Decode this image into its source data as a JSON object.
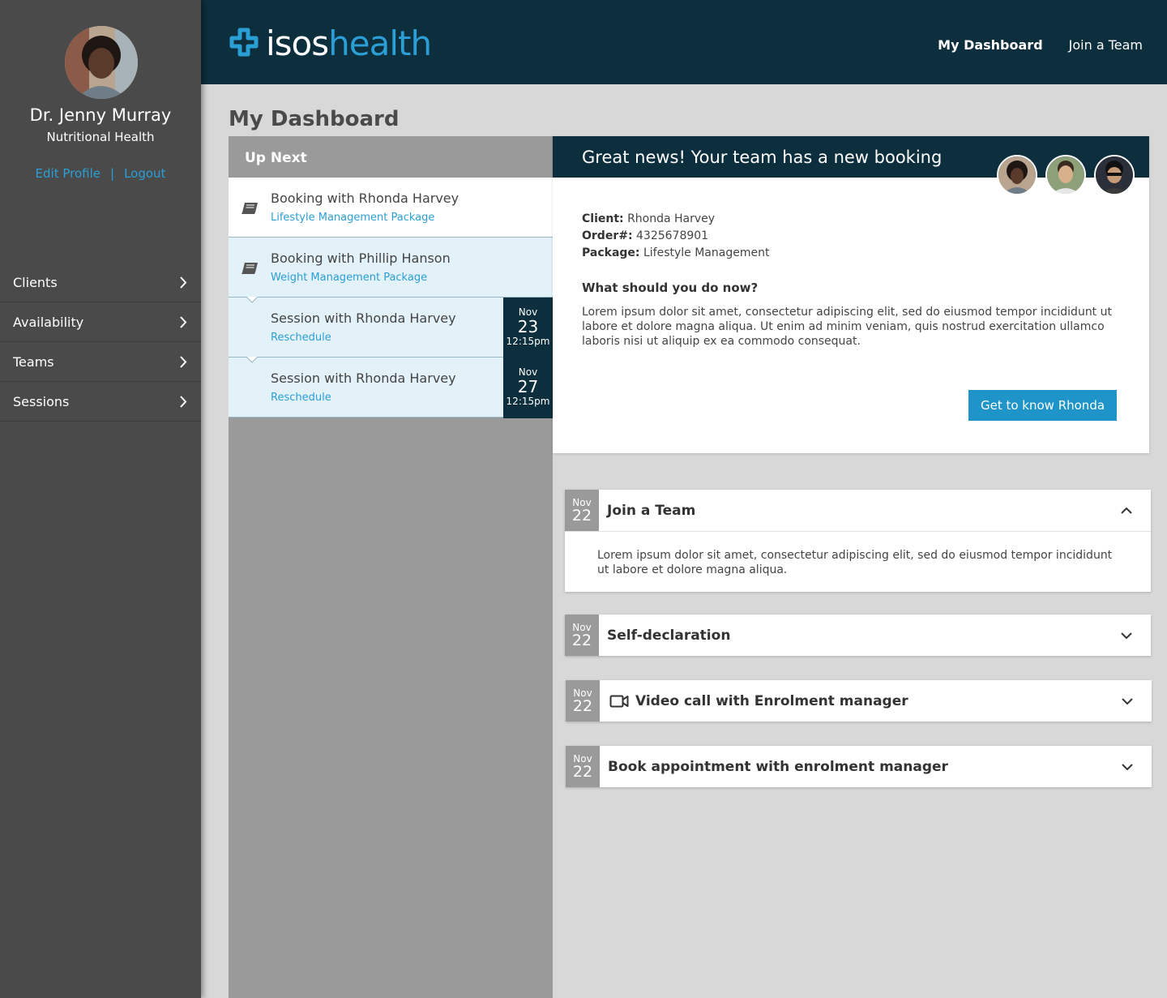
{
  "brand": {
    "logo_iso": "isos",
    "logo_health": "health",
    "accent_color": "#2a9fd6",
    "dark_color": "#0d2e3c"
  },
  "top_nav": {
    "dashboard": "My Dashboard",
    "join_team": "Join a Team"
  },
  "profile": {
    "name": "Dr. Jenny Murray",
    "role": "Nutritional Health",
    "edit_link": "Edit Profile",
    "separator": "|",
    "logout_link": "Logout"
  },
  "sidebar": {
    "items": [
      {
        "label": "Clients"
      },
      {
        "label": "Availability"
      },
      {
        "label": "Teams"
      },
      {
        "label": "Sessions"
      }
    ]
  },
  "page_title": "My Dashboard",
  "up_next": {
    "header": "Up Next",
    "items": [
      {
        "title": "Booking with Rhonda Harvey",
        "sub": "Lifestyle Management Package"
      },
      {
        "title": "Booking with Phillip Hanson",
        "sub": "Weight Management Package"
      },
      {
        "title": "Session with Rhonda Harvey",
        "sub": "Reschedule",
        "month": "Nov",
        "day": "23",
        "time": "12:15pm"
      },
      {
        "title": "Session with Rhonda Harvey",
        "sub": "Reschedule",
        "month": "Nov",
        "day": "27",
        "time": "12:15pm"
      }
    ]
  },
  "booking": {
    "header": "Great news! Your team has a new booking",
    "client_label": "Client:",
    "client_value": "Rhonda Harvey",
    "order_label": "Order#:",
    "order_value": "4325678901",
    "package_label": "Package:",
    "package_value": "Lifestyle Management",
    "question": "What should you do now?",
    "body": "Lorem ipsum dolor sit amet, consectetur adipiscing elit, sed do eiusmod tempor incididunt ut labore et dolore magna aliqua. Ut enim ad minim veniam, quis nostrud exercitation ullamco laboris nisi ut aliquip ex ea commodo consequat.",
    "button": "Get to know Rhonda"
  },
  "tasks": [
    {
      "month": "Nov",
      "day": "22",
      "title": "Join a Team",
      "expanded": true,
      "body": "Lorem ipsum dolor sit amet, consectetur adipiscing elit, sed do eiusmod tempor incididunt ut labore et dolore magna aliqua."
    },
    {
      "month": "Nov",
      "day": "22",
      "title": "Self-declaration",
      "expanded": false
    },
    {
      "month": "Nov",
      "day": "22",
      "title": "Video call with Enrolment manager",
      "icon": "video-camera-icon",
      "expanded": false
    },
    {
      "month": "Nov",
      "day": "22",
      "title": "Book appointment with enrolment manager",
      "expanded": false
    }
  ]
}
